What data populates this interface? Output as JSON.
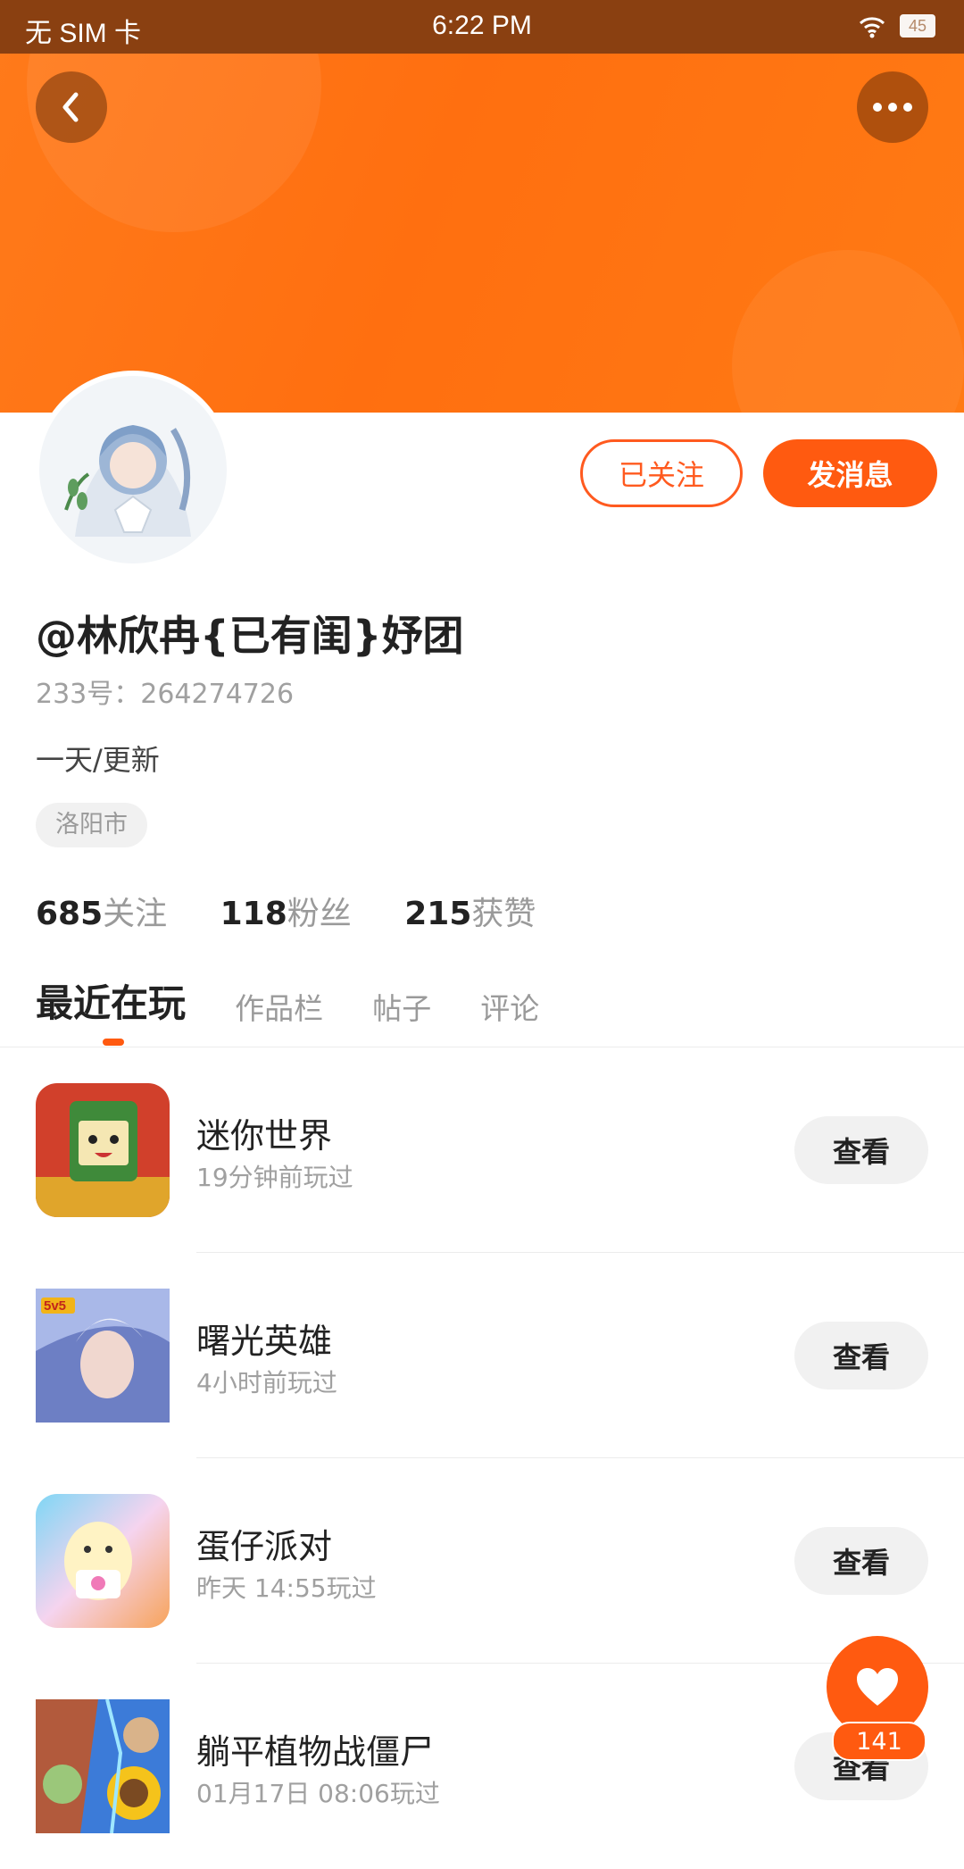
{
  "status_bar": {
    "carrier": "无 SIM 卡",
    "time": "6:22 PM",
    "battery": "45"
  },
  "profile": {
    "username": "@林欣冉{已有闺}妤团",
    "uid": "233号：264274726",
    "bio": "一天/更新",
    "location": "洛阳市",
    "follow_label": "已关注",
    "message_label": "发消息"
  },
  "stats": [
    {
      "num": "685",
      "label": "关注"
    },
    {
      "num": "118",
      "label": "粉丝"
    },
    {
      "num": "215",
      "label": "获赞"
    }
  ],
  "tabs": [
    "最近在玩",
    "作品栏",
    "帖子",
    "评论"
  ],
  "games": [
    {
      "name": "迷你世界",
      "time": "19分钟前玩过",
      "action": "查看"
    },
    {
      "name": "曙光英雄",
      "time": "4小时前玩过",
      "action": "查看"
    },
    {
      "name": "蛋仔派对",
      "time": "昨天 14:55玩过",
      "action": "查看"
    },
    {
      "name": "躺平植物战僵尸",
      "time": "01月17日 08:06玩过",
      "action": "查看"
    }
  ],
  "fab": {
    "count": "141"
  },
  "colors": {
    "accent": "#ff5a10",
    "hero": "#ff7a1a"
  }
}
